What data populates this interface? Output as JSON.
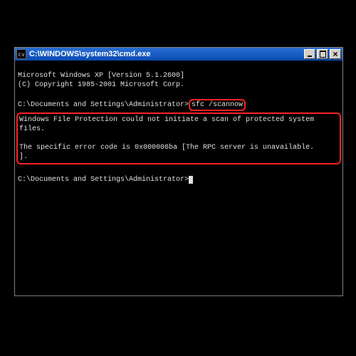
{
  "window": {
    "title": "C:\\WINDOWS\\system32\\cmd.exe",
    "icon_label": "cv"
  },
  "term": {
    "banner1": "Microsoft Windows XP [Version 5.1.2600]",
    "banner2": "(C) Copyright 1985-2001 Microsoft Corp.",
    "prompt_path": "C:\\Documents and Settings\\Administrator>",
    "command": "sfc /scannow",
    "error1": "Windows File Protection could not initiate a scan of protected system files.",
    "error2": "The specific error code is 0x000006ba [The RPC server is unavailable.\n]."
  }
}
